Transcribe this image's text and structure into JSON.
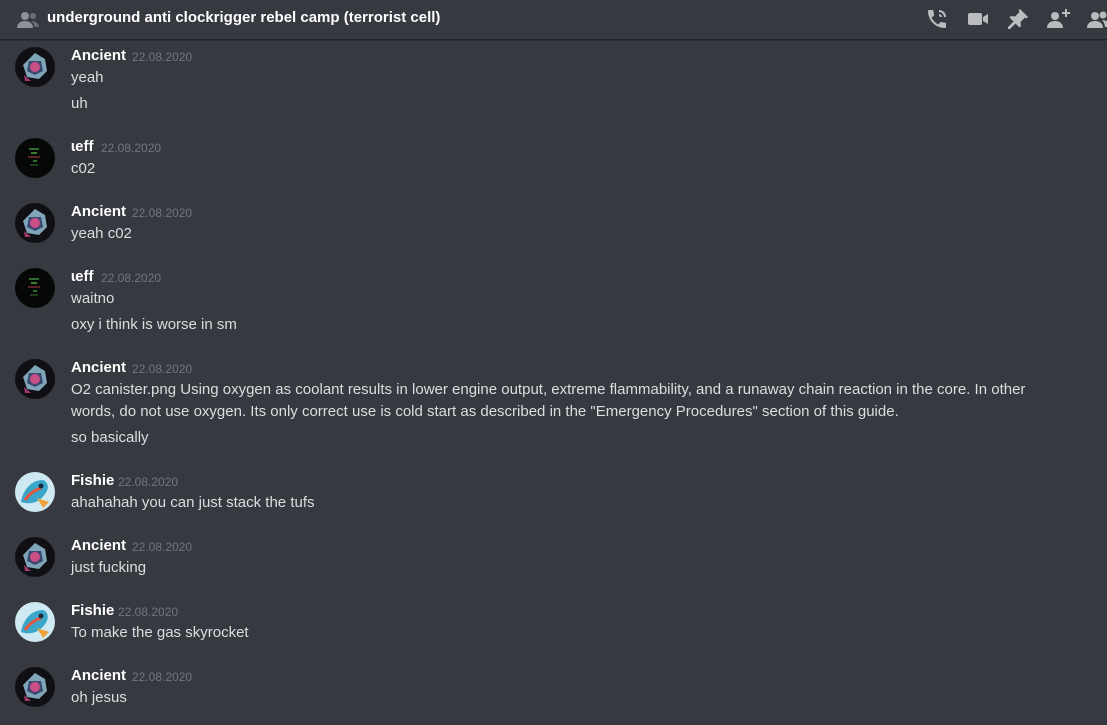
{
  "header": {
    "title": "underground anti clockrigger rebel camp (terrorist cell)",
    "icons": [
      "group-icon",
      "phone-call-icon",
      "video-call-icon",
      "pin-icon",
      "add-member-icon",
      "member-list-icon"
    ]
  },
  "colors": {
    "background": "#36393f",
    "author": "#ffffff",
    "text": "#dcddde",
    "timestamp": "#72767d",
    "header_icon": "#b9bbbe"
  },
  "messages": [
    {
      "author": "Ancient",
      "timestamp": "22.08.2020",
      "lines": [
        "yeah",
        "uh"
      ]
    },
    {
      "author": "ɩeff",
      "timestamp": "22.08.2020",
      "lines": [
        "c02"
      ]
    },
    {
      "author": "Ancient",
      "timestamp": "22.08.2020",
      "lines": [
        "yeah c02"
      ]
    },
    {
      "author": "ɩeff",
      "timestamp": "22.08.2020",
      "lines": [
        "waitno",
        "oxy i think is worse in sm"
      ]
    },
    {
      "author": "Ancient",
      "timestamp": "22.08.2020",
      "lines": [
        "O2 canister.png Using oxygen as coolant results in lower engine output, extreme flammability, and a runaway chain reaction in the core. In other words, do not use oxygen. Its only correct use is cold start as described in the \"Emergency Procedures\" section of this guide.",
        "so basically"
      ]
    },
    {
      "author": "Fishie",
      "timestamp": "22.08.2020",
      "lines": [
        "ahahahah you can just stack the tufs"
      ]
    },
    {
      "author": "Ancient",
      "timestamp": "22.08.2020",
      "lines": [
        "just fucking"
      ]
    },
    {
      "author": "Fishie",
      "timestamp": "22.08.2020",
      "lines": [
        "To make the gas skyrocket"
      ]
    },
    {
      "author": "Ancient",
      "timestamp": "22.08.2020",
      "lines": [
        "oh jesus"
      ]
    }
  ]
}
